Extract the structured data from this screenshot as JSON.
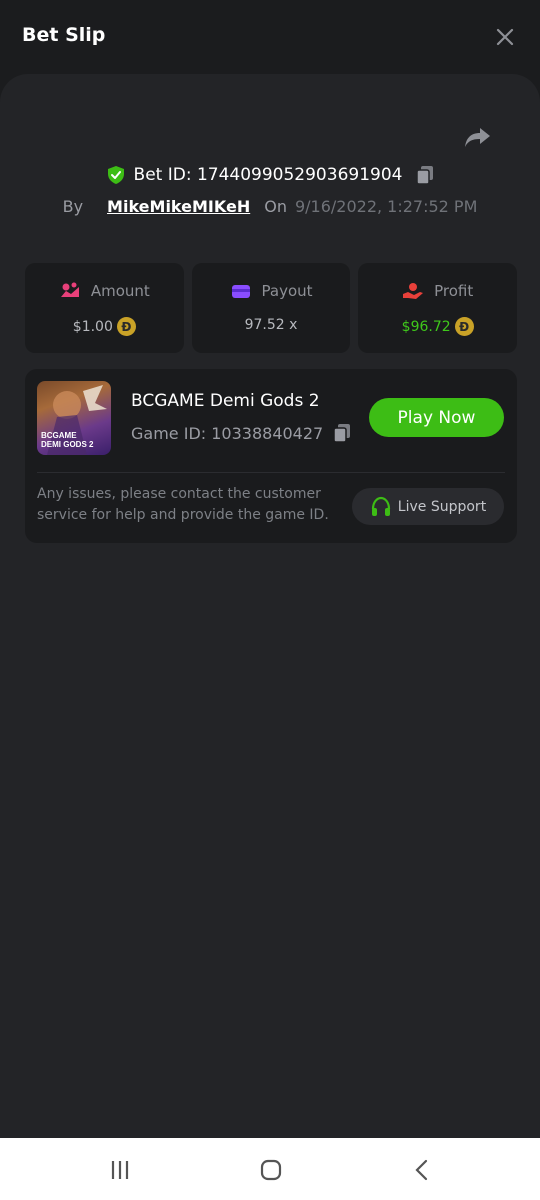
{
  "header": {
    "title": "Bet Slip"
  },
  "bet": {
    "id_label": "Bet ID: 1744099052903691904",
    "by_label": "By",
    "username": "MikeMikeMIKeH",
    "on_label": "On",
    "date": "9/16/2022, 1:27:52 PM"
  },
  "stats": {
    "amount": {
      "label": "Amount",
      "value": "$1.00"
    },
    "payout": {
      "label": "Payout",
      "value": "97.52 x"
    },
    "profit": {
      "label": "Profit",
      "value": "$96.72"
    },
    "coin_symbol": "Đ"
  },
  "game": {
    "title": "BCGAME Demi Gods 2",
    "game_id": "Game ID: 10338840427",
    "thumb_text_1": "BCGAME",
    "thumb_text_2": "DEMI GODS 2",
    "play_label": "Play Now",
    "issues_text": "Any issues, please contact the customer service for help and provide the game ID.",
    "live_support_label": "Live Support"
  },
  "colors": {
    "accent_green": "#3dbd15",
    "profit_green": "#3fc81b",
    "amount_icon": "#e8407a",
    "payout_icon": "#8a4dff",
    "profit_icon": "#e8403a"
  },
  "icons": {
    "close": "close-icon",
    "share": "share-icon",
    "shield": "shield-check-icon",
    "copy": "copy-icon",
    "coin": "doge-coin-icon",
    "headset": "headset-icon"
  }
}
